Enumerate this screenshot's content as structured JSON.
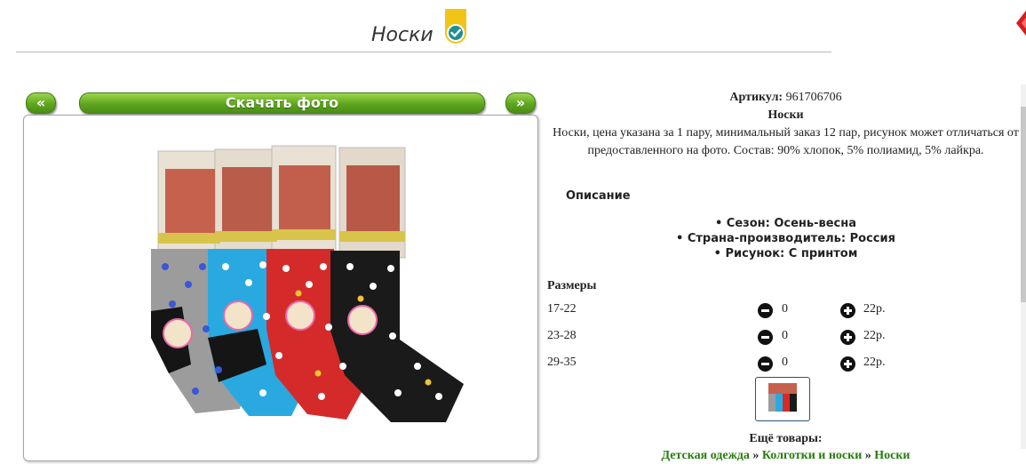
{
  "header": {
    "title": "Носки"
  },
  "gallery": {
    "prev_label": "«",
    "download_label": "Скачать фото",
    "next_label": "»"
  },
  "product": {
    "sku_label": "Артикул:",
    "sku": "961706706",
    "name": "Носки",
    "description": "Носки, цена указана за 1 пару, минимальный заказ 12 пар, рисунок может отличаться от предоставленного на фото. Состав: 90% хлопок, 5% полиамид, 5% лайкра."
  },
  "description_section": {
    "title": "Описание",
    "properties": [
      "Сезон: Осень-весна",
      "Страна-производитель: Россия",
      "Рисунок: С принтом"
    ]
  },
  "sizes": {
    "title": "Размеры",
    "rows": [
      {
        "size": "17-22",
        "qty": "0",
        "price": "22р."
      },
      {
        "size": "23-28",
        "qty": "0",
        "price": "22р."
      },
      {
        "size": "29-35",
        "qty": "0",
        "price": "22р."
      }
    ]
  },
  "more": {
    "title": "Ещё товары:",
    "breadcrumb": [
      "Детская одежда",
      "Колготки и носки",
      "Носки"
    ],
    "separator": "»"
  },
  "colors": {
    "accent_green": "#5fa51f",
    "link_green": "#2a7a11",
    "badge_yellow": "#f2c417",
    "badge_teal": "#1d8f95"
  },
  "icons": [
    "verified-badge-icon",
    "minus-icon",
    "plus-icon"
  ]
}
